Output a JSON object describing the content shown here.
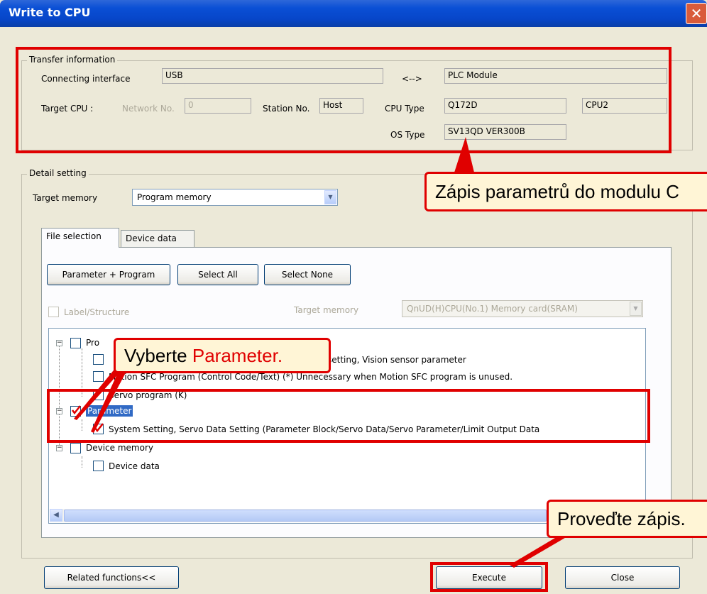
{
  "window": {
    "title": "Write to CPU",
    "close_glyph": "✕"
  },
  "transfer": {
    "group_label": "Transfer information",
    "connecting_interface_label": "Connecting interface",
    "connecting_interface_value": "USB",
    "arrow": "<-->",
    "plc_module": "PLC Module",
    "target_cpu_label": "Target CPU :",
    "network_label": "Network No.",
    "network_value": "0",
    "station_label": "Station No.",
    "station_value": "Host",
    "cpu_type_label": "CPU Type",
    "cpu_type_value": "Q172D",
    "cpu_slot": "CPU2",
    "os_type_label": "OS Type",
    "os_type_value": "SV13QD VER300B"
  },
  "detail": {
    "group_label": "Detail setting",
    "target_memory_label": "Target memory",
    "target_memory_value": "Program memory",
    "tabs": [
      "File selection",
      "Device data"
    ],
    "buttons": {
      "param_program": "Parameter + Program",
      "select_all": "Select All",
      "select_none": "Select None"
    },
    "label_structure": "Label/Structure",
    "target_memory2_label": "Target memory",
    "target_memory2_value": "QnUD(H)CPU(No.1) Memory card(SRAM)"
  },
  "tree": {
    "program_label": "Pro",
    "item_vision": "setting, Vision sensor parameter",
    "item_motion": "Motion SFC Program (Control Code/Text)  (*) Unnecessary when Motion SFC program is unused.",
    "item_servo": "Servo program (K)",
    "parameter": "Parameter",
    "system_setting": "System Setting, Servo Data Setting (Parameter Block/Servo Data/Servo Parameter/Limit Output Data",
    "device_memory": "Device memory",
    "device_data": "Device data"
  },
  "footer": {
    "related": "Related functions<<",
    "execute": "Execute",
    "close": "Close"
  },
  "callouts": {
    "transfer": "Zápis parametrů do modulu C",
    "select_prefix": "Vyberte ",
    "select_highlight": "Parameter.",
    "execute": "Proveďte zápis."
  },
  "colors": {
    "highlight_red": "#e00000",
    "title_blue": "#0a4fd5",
    "selection_blue": "#316ac5"
  }
}
